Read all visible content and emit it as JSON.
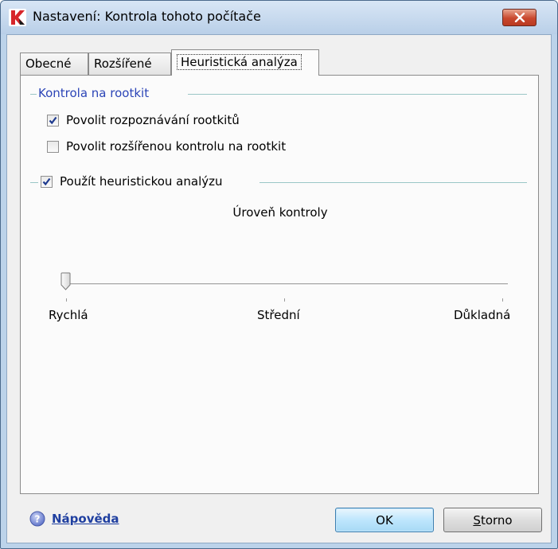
{
  "window": {
    "title": "Nastavení: Kontrola tohoto počítače"
  },
  "tabs": [
    {
      "label": "Obecné",
      "active": false
    },
    {
      "label": "Rozšířené",
      "active": false
    },
    {
      "label": "Heuristická analýza",
      "active": true
    }
  ],
  "rootkit_group": {
    "title": "Kontrola na rootkit",
    "checkboxes": [
      {
        "label": "Povolit rozpoznávání rootkitů",
        "checked": true
      },
      {
        "label": "Povolit rozšířenou kontrolu na rootkit",
        "checked": false
      }
    ]
  },
  "heuristic_group": {
    "label": "Použít heuristickou analýzu",
    "checked": true
  },
  "slider": {
    "title": "Úroveň kontroly",
    "labels": [
      "Rychlá",
      "Střední",
      "Důkladná"
    ],
    "selected": "Rychlá"
  },
  "footer": {
    "help_label": "Nápověda",
    "ok_label": "OK",
    "cancel_label_first": "S",
    "cancel_label_rest": "torno"
  },
  "colors": {
    "group_title": "#2c45b7",
    "link": "#1f3fa0",
    "brand_icon": "#d7262b"
  },
  "icons": {
    "app": "kaspersky-k-icon",
    "close": "close-x-icon",
    "help": "help-question-icon",
    "check": "checkmark-icon"
  }
}
